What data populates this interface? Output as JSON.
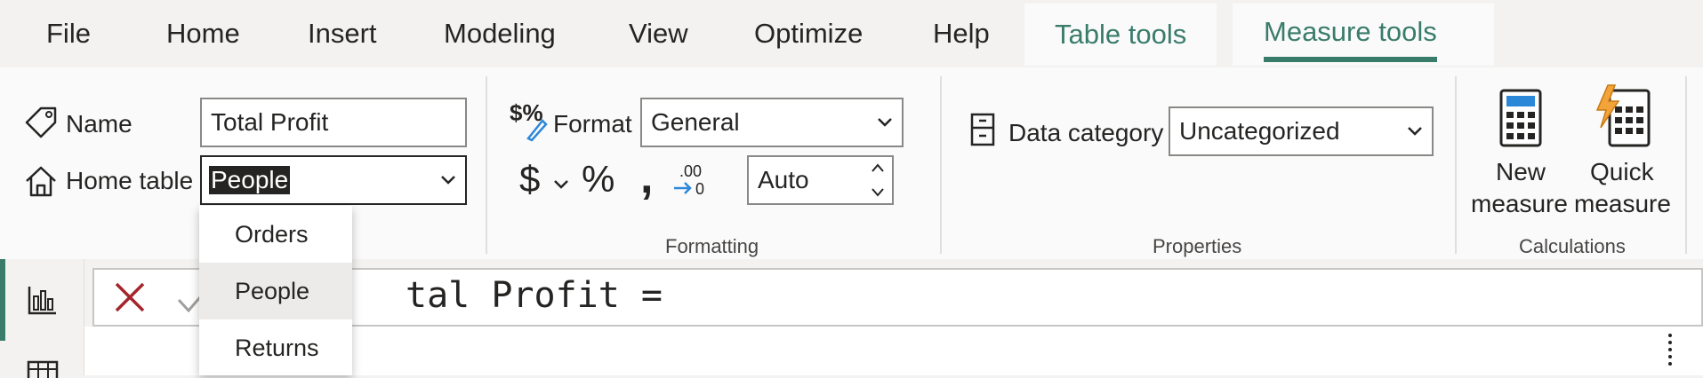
{
  "menu": {
    "file": "File",
    "home": "Home",
    "insert": "Insert",
    "modeling": "Modeling",
    "view": "View",
    "optimize": "Optimize",
    "help": "Help",
    "table_tools": "Table tools",
    "measure_tools": "Measure tools"
  },
  "structure": {
    "name_label": "Name",
    "name_value": "Total Profit",
    "home_table_label": "Home table",
    "home_table_value": "People"
  },
  "formatting": {
    "format_label": "Format",
    "format_value": "General",
    "currency_symbol": "$",
    "percent_symbol": "%",
    "comma_symbol": ",",
    "decimal_value": "Auto",
    "group_title": "Formatting"
  },
  "properties": {
    "data_category_label": "Data category",
    "data_category_value": "Uncategorized",
    "group_title": "Properties"
  },
  "calculations": {
    "new_measure_line1": "New",
    "new_measure_line2": "measure",
    "quick_measure_line1": "Quick",
    "quick_measure_line2": "measure",
    "group_title": "Calculations"
  },
  "dropdown": {
    "options": [
      "Orders",
      "People",
      "Returns"
    ],
    "selected": "People"
  },
  "formula": {
    "visible_text": "tal Profit ="
  },
  "colors": {
    "accent": "#3a7c6a",
    "cancel": "#a4262c",
    "blue_accent": "#2b88d8",
    "quick_orange": "#f2a33a"
  }
}
